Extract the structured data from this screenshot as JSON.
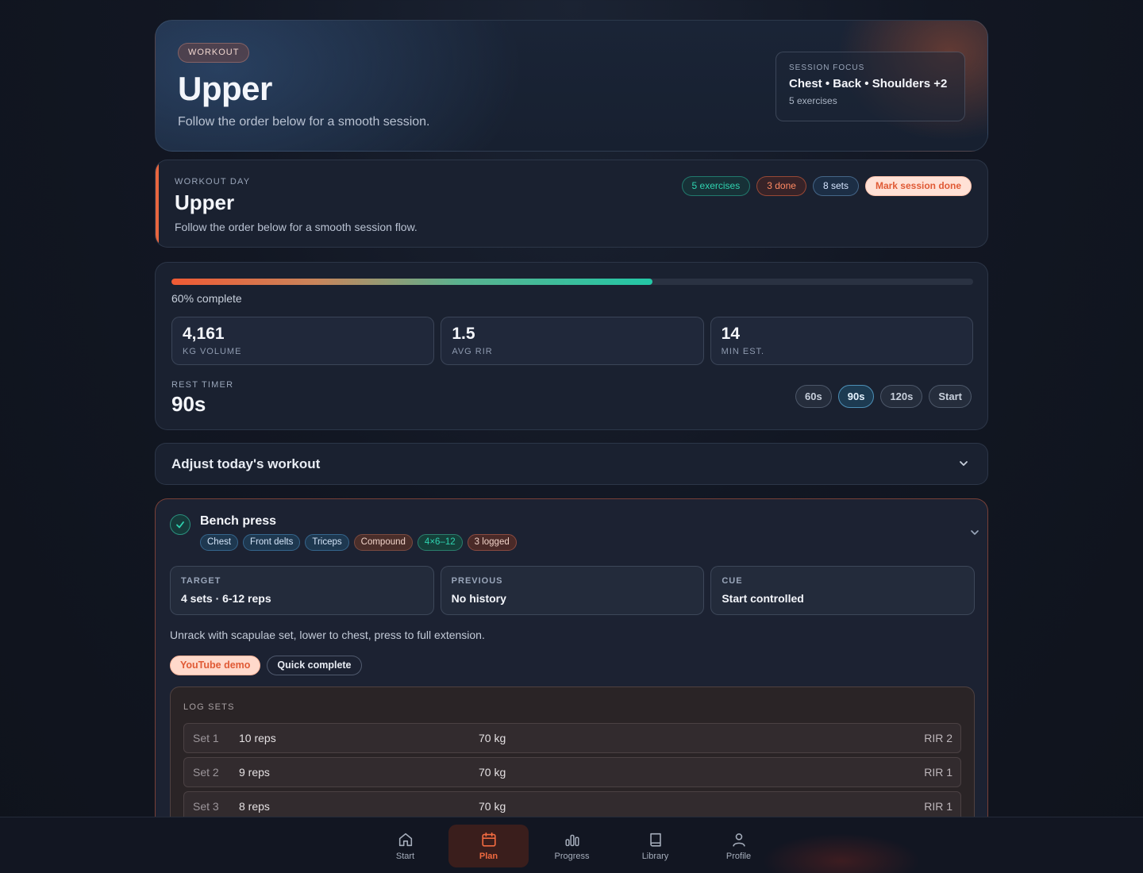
{
  "hero": {
    "badge": "WORKOUT",
    "title": "Upper",
    "subtitle": "Follow the order below for a smooth session.",
    "focus": {
      "label": "SESSION FOCUS",
      "value": "Chest • Back • Shoulders +2",
      "count": "5 exercises"
    }
  },
  "day": {
    "label": "WORKOUT DAY",
    "title": "Upper",
    "subtitle": "Follow the order below for a smooth session flow.",
    "chips": {
      "exercises": "5 exercises",
      "done": "3 done",
      "sets": "8 sets",
      "mark": "Mark session done"
    }
  },
  "progress": {
    "fraction": 0.6,
    "label": "60% complete",
    "stats": [
      {
        "value": "4,161",
        "label": "KG VOLUME"
      },
      {
        "value": "1.5",
        "label": "AVG RIR"
      },
      {
        "value": "14",
        "label": "MIN EST."
      }
    ],
    "rest": {
      "label": "REST TIMER",
      "value": "90s",
      "options": [
        "60s",
        "90s",
        "120s"
      ],
      "selected": "90s",
      "start": "Start"
    }
  },
  "adjust": {
    "title": "Adjust today's workout"
  },
  "exercise": {
    "title": "Bench press",
    "tags": {
      "muscles": [
        "Chest",
        "Front delts",
        "Triceps"
      ],
      "type": "Compound",
      "scheme": "4×6–12",
      "logged": "3 logged"
    },
    "info": [
      {
        "label": "TARGET",
        "value": "4 sets · 6-12 reps"
      },
      {
        "label": "PREVIOUS",
        "value": "No history"
      },
      {
        "label": "CUE",
        "value": "Start controlled"
      }
    ],
    "description": "Unrack with scapulae set, lower to chest, press to full extension.",
    "actions": {
      "youtube": "YouTube demo",
      "quick": "Quick complete"
    },
    "log": {
      "label": "LOG SETS",
      "sets": [
        {
          "set": "Set 1",
          "reps": "10 reps",
          "kg": "70 kg",
          "rir": "RIR 2"
        },
        {
          "set": "Set 2",
          "reps": "9 reps",
          "kg": "70 kg",
          "rir": "RIR 1"
        },
        {
          "set": "Set 3",
          "reps": "8 reps",
          "kg": "70 kg",
          "rir": "RIR 1"
        }
      ]
    }
  },
  "nav": {
    "items": [
      {
        "label": "Start",
        "icon": "home-icon"
      },
      {
        "label": "Plan",
        "icon": "calendar-icon",
        "active": true
      },
      {
        "label": "Progress",
        "icon": "bar-chart-icon"
      },
      {
        "label": "Library",
        "icon": "book-icon"
      },
      {
        "label": "Profile",
        "icon": "user-icon"
      }
    ]
  },
  "colors": {
    "accent": "#e8663f",
    "teal": "#2fd3b0",
    "background": "#121723",
    "card": "#1a2130"
  }
}
